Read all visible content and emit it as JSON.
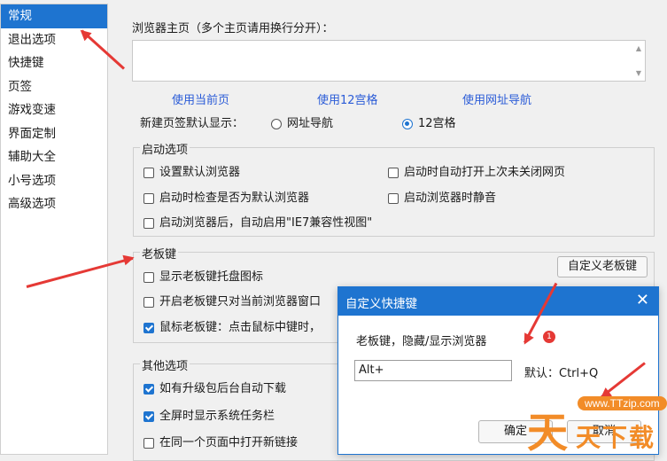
{
  "sidebar": {
    "items": [
      {
        "label": "常规",
        "active": true
      },
      {
        "label": "退出选项"
      },
      {
        "label": "快捷键"
      },
      {
        "label": "页签"
      },
      {
        "label": "游戏变速"
      },
      {
        "label": "界面定制"
      },
      {
        "label": "辅助大全"
      },
      {
        "label": "小号选项"
      },
      {
        "label": "高级选项"
      }
    ]
  },
  "homepage": {
    "label": "浏览器主页（多个主页请用换行分开）：",
    "value": "",
    "links": [
      "使用当前页",
      "使用12宫格",
      "使用网址导航"
    ]
  },
  "newtab": {
    "label": "新建页签默认显示：",
    "options": [
      {
        "label": "网址导航",
        "selected": false
      },
      {
        "label": "12宫格",
        "selected": true
      }
    ]
  },
  "startup": {
    "title": "启动选项",
    "options": [
      {
        "label": "设置默认浏览器",
        "checked": false
      },
      {
        "label": "启动时自动打开上次未关闭网页",
        "checked": false
      },
      {
        "label": "启动时检查是否为默认浏览器",
        "checked": false
      },
      {
        "label": "启动浏览器时静音",
        "checked": false
      },
      {
        "label": "启动浏览器后，自动启用\"IE7兼容性视图\"",
        "checked": false
      }
    ]
  },
  "bosskey": {
    "title": "老板键",
    "options": [
      {
        "label": "显示老板键托盘图标",
        "checked": false
      },
      {
        "label": "开启老板键只对当前浏览器窗口",
        "checked": false
      },
      {
        "label": "鼠标老板键：点击鼠标中键时，",
        "checked": true
      }
    ],
    "custom_button": "自定义老板键"
  },
  "other": {
    "title": "其他选项",
    "options": [
      {
        "label": "如有升级包后台自动下载",
        "checked": true
      },
      {
        "label": "全屏时显示系统任务栏",
        "checked": true
      },
      {
        "label": "在同一个页面中打开新链接",
        "checked": false
      }
    ]
  },
  "dialog": {
    "title": "自定义快捷键",
    "close": "✕",
    "prompt": "老板键，隐藏/显示浏览器",
    "input_value": "Alt+",
    "default_text": "默认：Ctrl+Q",
    "ok_button": "确定",
    "cancel_button": "取消",
    "badge": "1"
  },
  "watermark": {
    "url": "www.TTzip.com",
    "logo": "天",
    "sub": "天下载"
  },
  "colors": {
    "accent": "#1e74d0",
    "link": "#2a5bd7",
    "annotation": "#e53935",
    "watermark": "#f28c28"
  }
}
